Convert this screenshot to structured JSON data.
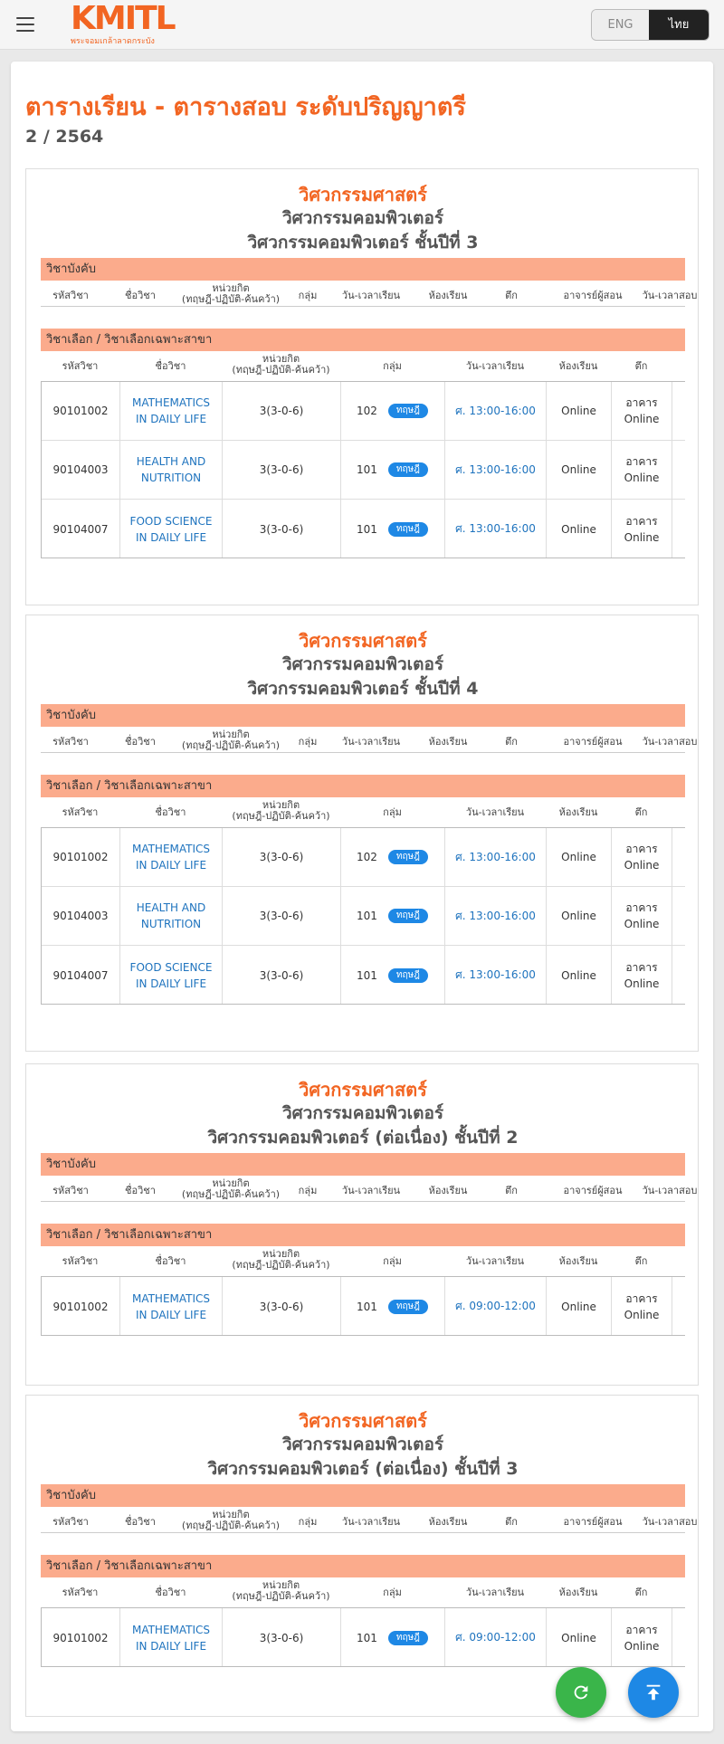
{
  "header": {
    "logo_text": "KMITL",
    "logo_sub": "พระจอมเกล้าลาดกระบัง",
    "lang_eng": "ENG",
    "lang_thai": "ไทย"
  },
  "page": {
    "title": "ตารางเรียน - ตารางสอบ ระดับปริญญาตรี",
    "term": "2 / 2564"
  },
  "labels": {
    "required": "วิชาบังคับ",
    "elective": "วิชาเลือก / วิชาเลือกเฉพาะสาขา",
    "col_code": "รหัสวิชา",
    "col_name": "ชื่อวิชา",
    "col_credit_1": "หน่วยกิต",
    "col_credit_2": "(ทฤษฎี-ปฏิบัติ-ค้นคว้า)",
    "col_group": "กลุ่ม",
    "col_time": "วัน-เวลาเรียน",
    "col_room": "ห้องเรียน",
    "col_building": "ตึก",
    "col_teacher": "อาจารย์ผู้สอน",
    "col_exam": "วัน-เวลาสอบ",
    "badge": "ทฤษฎี"
  },
  "sections": [
    {
      "faculty": "วิศวกรรมศาสตร์",
      "department": "วิศวกรรมคอมพิวเตอร์",
      "program": "วิศวกรรมคอมพิวเตอร์ ชั้นปีที่ 3",
      "courses": [
        {
          "code": "90101002",
          "name": "MATHEMATICS IN DAILY LIFE",
          "credit": "3(3-0-6)",
          "group": "102",
          "time": "ศ. 13:00-16:00",
          "room": "Online",
          "building": "อาคาร Online"
        },
        {
          "code": "90104003",
          "name": "HEALTH AND NUTRITION",
          "credit": "3(3-0-6)",
          "group": "101",
          "time": "ศ. 13:00-16:00",
          "room": "Online",
          "building": "อาคาร Online"
        },
        {
          "code": "90104007",
          "name": "FOOD SCIENCE IN DAILY LIFE",
          "credit": "3(3-0-6)",
          "group": "101",
          "time": "ศ. 13:00-16:00",
          "room": "Online",
          "building": "อาคาร Online"
        }
      ]
    },
    {
      "faculty": "วิศวกรรมศาสตร์",
      "department": "วิศวกรรมคอมพิวเตอร์",
      "program": "วิศวกรรมคอมพิวเตอร์ ชั้นปีที่ 4",
      "courses": [
        {
          "code": "90101002",
          "name": "MATHEMATICS IN DAILY LIFE",
          "credit": "3(3-0-6)",
          "group": "102",
          "time": "ศ. 13:00-16:00",
          "room": "Online",
          "building": "อาคาร Online"
        },
        {
          "code": "90104003",
          "name": "HEALTH AND NUTRITION",
          "credit": "3(3-0-6)",
          "group": "101",
          "time": "ศ. 13:00-16:00",
          "room": "Online",
          "building": "อาคาร Online"
        },
        {
          "code": "90104007",
          "name": "FOOD SCIENCE IN DAILY LIFE",
          "credit": "3(3-0-6)",
          "group": "101",
          "time": "ศ. 13:00-16:00",
          "room": "Online",
          "building": "อาคาร Online"
        }
      ]
    },
    {
      "faculty": "วิศวกรรมศาสตร์",
      "department": "วิศวกรรมคอมพิวเตอร์",
      "program": "วิศวกรรมคอมพิวเตอร์ (ต่อเนื่อง) ชั้นปีที่ 2",
      "courses": [
        {
          "code": "90101002",
          "name": "MATHEMATICS IN DAILY LIFE",
          "credit": "3(3-0-6)",
          "group": "101",
          "time": "ศ. 09:00-12:00",
          "room": "Online",
          "building": "อาคาร Online"
        }
      ]
    },
    {
      "faculty": "วิศวกรรมศาสตร์",
      "department": "วิศวกรรมคอมพิวเตอร์",
      "program": "วิศวกรรมคอมพิวเตอร์ (ต่อเนื่อง) ชั้นปีที่ 3",
      "courses": [
        {
          "code": "90101002",
          "name": "MATHEMATICS IN DAILY LIFE",
          "credit": "3(3-0-6)",
          "group": "101",
          "time": "ศ. 09:00-12:00",
          "room": "Online",
          "building": "อาคาร Online"
        }
      ]
    }
  ],
  "colors": {
    "accent": "#f26522",
    "bar": "#fbab8c",
    "link": "#1e73be",
    "badge": "#1e88e5",
    "refresh": "#3ab54a"
  },
  "icons": {
    "menu": "hamburger-icon",
    "refresh": "refresh-icon",
    "top": "arrow-up-icon"
  }
}
